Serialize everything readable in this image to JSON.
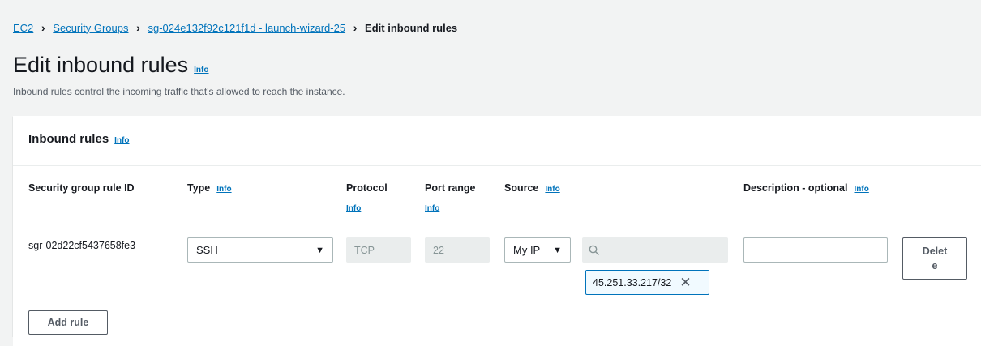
{
  "breadcrumb": {
    "items": [
      "EC2",
      "Security Groups",
      "sg-024e132f92c121f1d - launch-wizard-25"
    ],
    "current": "Edit inbound rules",
    "separator": ">"
  },
  "page": {
    "title": "Edit inbound rules",
    "info": "Info",
    "description": "Inbound rules control the incoming traffic that's allowed to reach the instance."
  },
  "panel": {
    "title": "Inbound rules",
    "info": "Info"
  },
  "columns": {
    "rule_id": "Security group rule ID",
    "type": "Type",
    "type_info": "Info",
    "protocol": "Protocol",
    "protocol_info": "Info",
    "port_range": "Port range",
    "port_info": "Info",
    "source": "Source",
    "source_info": "Info",
    "description": "Description - optional",
    "description_info": "Info"
  },
  "rule": {
    "id": "sgr-02d22cf5437658fe3",
    "type": "SSH",
    "protocol": "TCP",
    "port_range": "22",
    "source": "My IP",
    "source_search_placeholder": "",
    "cidr": "45.251.33.217/32",
    "description_value": "",
    "delete_label_line1": "Delet",
    "delete_label_line2": "e"
  },
  "actions": {
    "add_rule": "Add rule"
  },
  "colors": {
    "link": "#0073bb",
    "background": "#f2f3f3",
    "panel": "#ffffff",
    "disabled": "#eaeded"
  }
}
